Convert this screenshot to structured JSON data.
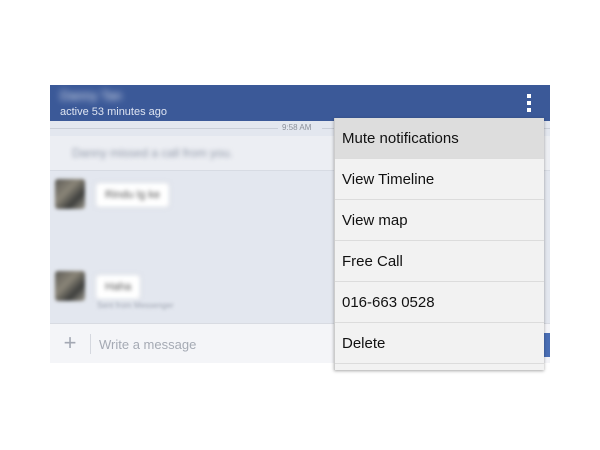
{
  "header": {
    "contact_name": "Danny Tan",
    "active_status": "active 53 minutes ago",
    "overflow_icon": "overflow-menu-icon"
  },
  "thread": {
    "time_label": "9:58 AM",
    "missed_call_text": "Danny missed a call from you.",
    "messages": [
      {
        "text": "Rindu lg ke"
      },
      {
        "text": "Haha",
        "meta": "Sent from Messenger"
      }
    ]
  },
  "composer": {
    "add_icon": "plus-icon",
    "placeholder": "Write a message"
  },
  "menu": {
    "items": [
      {
        "label": "Mute notifications"
      },
      {
        "label": "View Timeline"
      },
      {
        "label": "View map"
      },
      {
        "label": "Free Call"
      },
      {
        "label": "016-663 0528"
      },
      {
        "label": "Delete"
      }
    ]
  },
  "colors": {
    "header_bg": "#3b5998",
    "thread_bg": "#e3e7ef",
    "menu_bg": "#f2f2f2",
    "menu_highlight": "#dddddd"
  }
}
